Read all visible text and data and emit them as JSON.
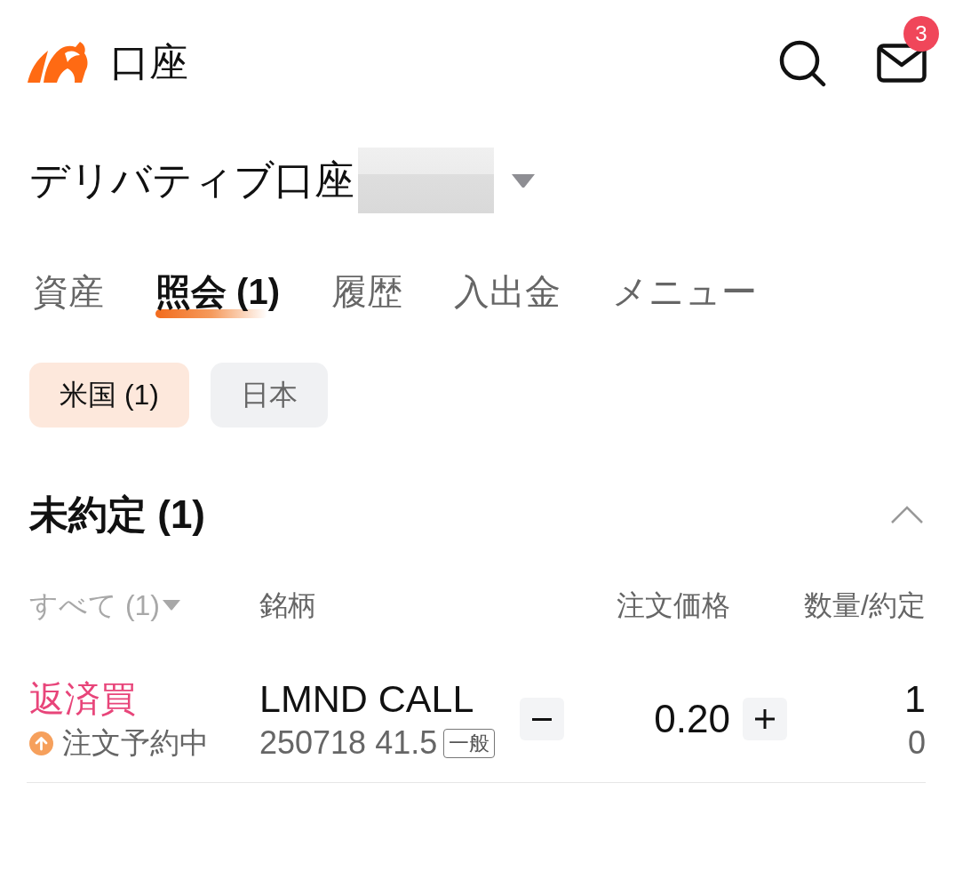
{
  "header": {
    "title": "口座",
    "notification_badge": "3"
  },
  "account": {
    "name": "デリバティブ口座"
  },
  "tabs": [
    {
      "label": "資産",
      "selected": false
    },
    {
      "label": "照会 (1)",
      "selected": true
    },
    {
      "label": "履歴",
      "selected": false
    },
    {
      "label": "入出金",
      "selected": false
    },
    {
      "label": "メニュー",
      "selected": false
    }
  ],
  "market_filters": [
    {
      "label": "米国 (1)",
      "selected": true
    },
    {
      "label": "日本",
      "selected": false
    }
  ],
  "section": {
    "title": "未約定 (1)",
    "expanded": true,
    "columns": [
      {
        "label": "すべて (1)",
        "kind": "filter"
      },
      {
        "label": "銘柄",
        "kind": "plain"
      },
      {
        "label": "注文価格",
        "kind": "plain"
      },
      {
        "label": "数量/約定",
        "kind": "plain"
      }
    ],
    "orders": [
      {
        "side": "返済買",
        "status": "注文予約中",
        "symbol": "LMND CALL",
        "detail": "250718 41.5",
        "account_tag": "一般",
        "price": "0.20",
        "quantity": "1",
        "filled": "0"
      }
    ]
  }
}
